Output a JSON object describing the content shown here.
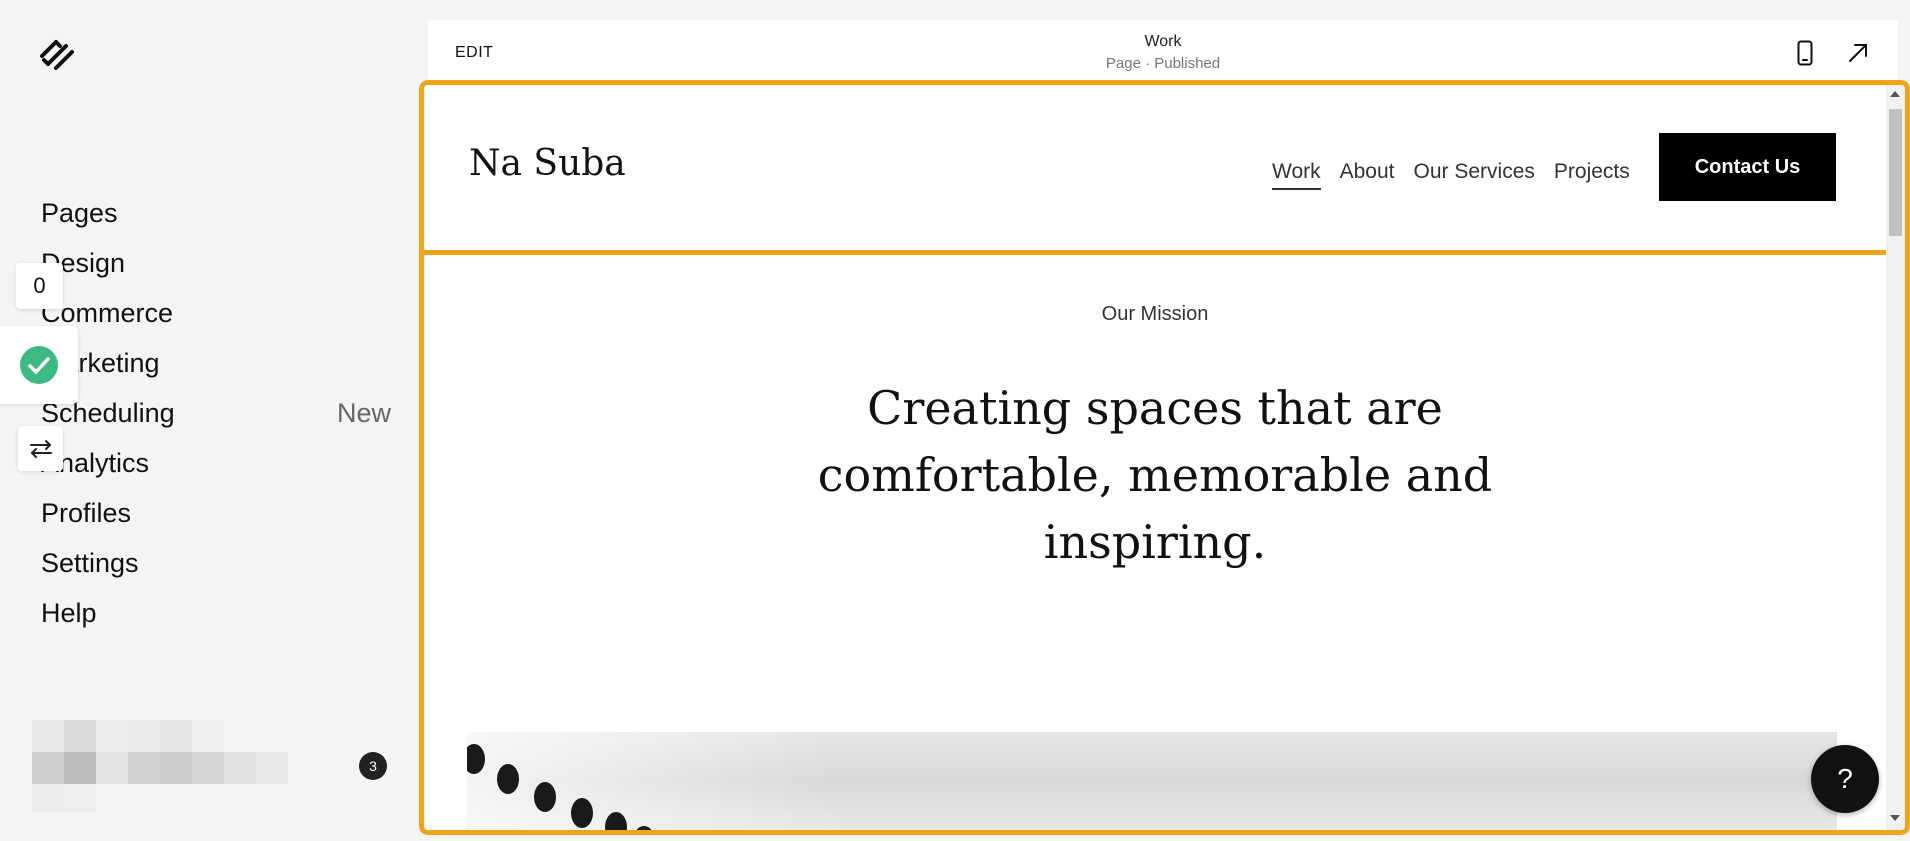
{
  "sidebar": {
    "logo_icon": "squarespace-logo-icon",
    "items": [
      {
        "label": "Pages"
      },
      {
        "label": "Design"
      },
      {
        "label": "Commerce"
      },
      {
        "label": "Marketing"
      },
      {
        "label": "Scheduling",
        "badge": "New"
      },
      {
        "label": "Analytics"
      },
      {
        "label": "Profiles"
      },
      {
        "label": "Settings"
      },
      {
        "label": "Help"
      }
    ],
    "float_count": "0",
    "notification_count": "3"
  },
  "topbar": {
    "edit_label": "EDIT",
    "page_title": "Work",
    "page_status": "Page · Published",
    "mobile_icon": "mobile-preview-icon",
    "open_icon": "open-external-icon"
  },
  "site": {
    "logo": "Na Suba",
    "nav": [
      "Work",
      "About",
      "Our Services",
      "Projects"
    ],
    "active_nav": "Work",
    "cta": "Contact Us",
    "mission_label": "Our Mission",
    "headline_lines": [
      "Creating spaces that are",
      "comfortable, memorable and",
      "inspiring."
    ]
  },
  "help_button": "?",
  "colors": {
    "accent": "#f0a41c",
    "check_green": "#3fb983",
    "cta_bg": "#000000"
  }
}
